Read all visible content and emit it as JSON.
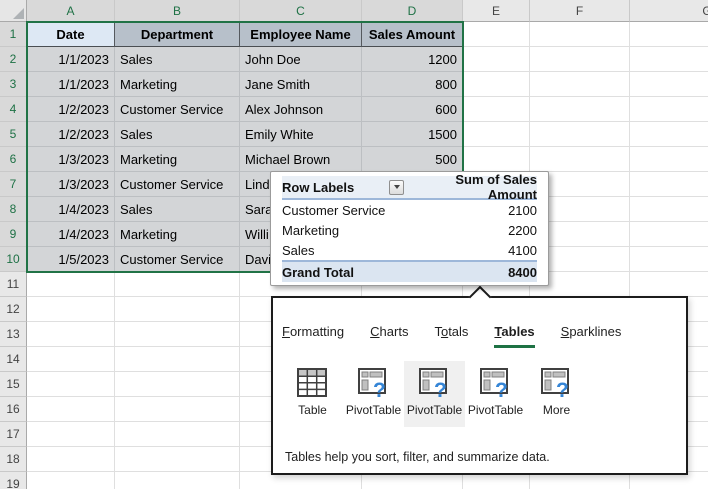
{
  "colors": {
    "selection_green": "#217346",
    "question_mark_blue": "#3585D6",
    "pivot_line_blue": "#9DB7D9",
    "header_fill_blue": "#DDE8F4",
    "header_fill_gray_blue": "#B7C0CA"
  },
  "sheet": {
    "column_letters": [
      "A",
      "B",
      "C",
      "D",
      "E",
      "F",
      "G"
    ],
    "row_numbers": [
      "1",
      "2",
      "3",
      "4",
      "5",
      "6",
      "7",
      "8",
      "9",
      "10",
      "11",
      "12",
      "13",
      "14",
      "15",
      "16",
      "17",
      "18",
      "19"
    ],
    "selected_columns": [
      "A",
      "B",
      "C",
      "D"
    ],
    "selected_rows": "1-10",
    "table": {
      "headers": [
        "Date",
        "Department",
        "Employee Name",
        "Sales Amount"
      ],
      "rows": [
        {
          "date": "1/1/2023",
          "department": "Sales",
          "employee": "John Doe",
          "amount": "1200"
        },
        {
          "date": "1/1/2023",
          "department": "Marketing",
          "employee": "Jane Smith",
          "amount": "800"
        },
        {
          "date": "1/2/2023",
          "department": "Customer Service",
          "employee": "Alex Johnson",
          "amount": "600"
        },
        {
          "date": "1/2/2023",
          "department": "Sales",
          "employee": "Emily White",
          "amount": "1500"
        },
        {
          "date": "1/3/2023",
          "department": "Marketing",
          "employee": "Michael Brown",
          "amount": "500"
        },
        {
          "date": "1/3/2023",
          "department": "Customer Service",
          "employee": "Lind",
          "amount": ""
        },
        {
          "date": "1/4/2023",
          "department": "Sales",
          "employee": "Sara",
          "amount": ""
        },
        {
          "date": "1/4/2023",
          "department": "Marketing",
          "employee": "Willi",
          "amount": ""
        },
        {
          "date": "1/5/2023",
          "department": "Customer Service",
          "employee": "Davi",
          "amount": ""
        }
      ]
    }
  },
  "pivot_preview": {
    "header": {
      "row_labels": "Row Labels",
      "values_label": "Sum of Sales Amount"
    },
    "rows": [
      {
        "label": "Customer Service",
        "value": "2100"
      },
      {
        "label": "Marketing",
        "value": "2200"
      },
      {
        "label": "Sales",
        "value": "4100"
      }
    ],
    "grand_total": {
      "label": "Grand Total",
      "value": "8400"
    }
  },
  "quick_analysis": {
    "tabs": [
      {
        "label": "Formatting",
        "underline_index": 0,
        "active": false
      },
      {
        "label": "Charts",
        "underline_index": 0,
        "active": false
      },
      {
        "label": "Totals",
        "underline_index": 1,
        "active": false
      },
      {
        "label": "Tables",
        "underline_index": 0,
        "active": true
      },
      {
        "label": "Sparklines",
        "underline_index": 0,
        "active": false
      }
    ],
    "items": [
      {
        "label": "Table",
        "icon": "table",
        "highlighted": false
      },
      {
        "label": "PivotTable",
        "icon": "pivot",
        "highlighted": false
      },
      {
        "label": "PivotTable",
        "icon": "pivot",
        "highlighted": true
      },
      {
        "label": "PivotTable",
        "icon": "pivot",
        "highlighted": false
      },
      {
        "label": "More",
        "icon": "pivot",
        "highlighted": false
      }
    ],
    "description": "Tables help you sort, filter, and summarize data."
  }
}
